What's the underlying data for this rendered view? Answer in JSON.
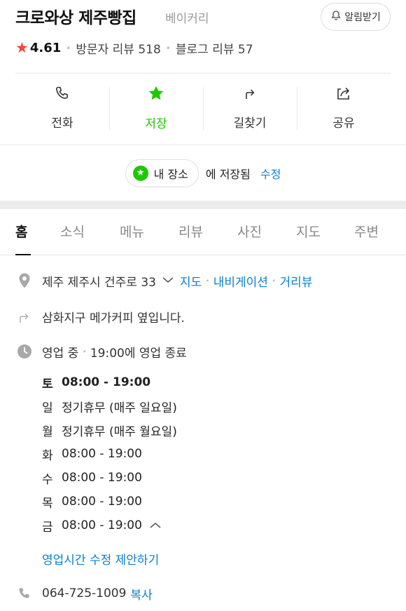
{
  "place": {
    "name": "크로와상 제주빵집",
    "category": "베이커리",
    "alarm_label": "알림받기",
    "rating": "4.61",
    "visitor_reviews": "방문자 리뷰 518",
    "blog_reviews": "블로그 리뷰 57"
  },
  "actions": [
    {
      "label": "전화",
      "icon": "phone-icon"
    },
    {
      "label": "저장",
      "icon": "star-icon"
    },
    {
      "label": "길찾기",
      "icon": "directions-icon"
    },
    {
      "label": "공유",
      "icon": "share-icon"
    }
  ],
  "saved": {
    "chip_label": "내 장소",
    "suffix": "에 저장됨",
    "edit_label": "수정"
  },
  "tabs": [
    "홈",
    "소식",
    "메뉴",
    "리뷰",
    "사진",
    "지도",
    "주변"
  ],
  "info": {
    "address": "제주 제주시 건주로 33",
    "map_link": "지도",
    "navi_link": "내비게이션",
    "street_link": "거리뷰",
    "directions_note": "삼화지구 메가커피 옆입니다.",
    "status_open": "영업 중",
    "status_close": "19:00에 영업 종료",
    "hours": [
      {
        "day": "토",
        "time": "08:00 - 19:00"
      },
      {
        "day": "일",
        "time": "정기휴무 (매주 일요일)"
      },
      {
        "day": "월",
        "time": "정기휴무 (매주 월요일)"
      },
      {
        "day": "화",
        "time": "08:00 - 19:00"
      },
      {
        "day": "수",
        "time": "08:00 - 19:00"
      },
      {
        "day": "목",
        "time": "08:00 - 19:00"
      },
      {
        "day": "금",
        "time": "08:00 - 19:00"
      }
    ],
    "hours_suggest": "영업시간 수정 제안하기",
    "phone": "064-725-1009",
    "copy_label": "복사"
  },
  "colors": {
    "accent_green": "#1ec800",
    "link_blue": "#0b7fd1",
    "star_red": "#f3473c"
  }
}
